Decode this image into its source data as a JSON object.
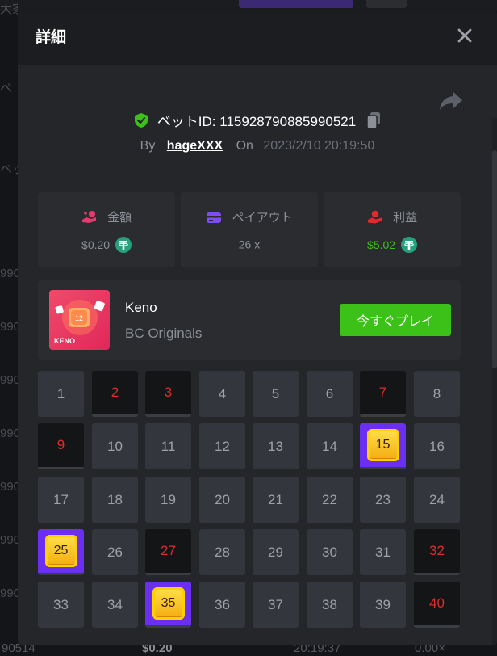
{
  "modal": {
    "title": "詳細",
    "bet_id_label": "ベットID: 115928790885990521",
    "by_label": "By",
    "username": "hageXXX",
    "on_label": "On",
    "datetime": "2023/2/10 20:19:50"
  },
  "stats": [
    {
      "label": "金額",
      "value": "$0.20",
      "icon": "coins-hand-icon",
      "currency_icon": "usdt-icon"
    },
    {
      "label": "ペイアウト",
      "value": "26 x",
      "icon": "wallet-card-icon"
    },
    {
      "label": "利益",
      "value": "$5.02",
      "icon": "profit-hand-icon",
      "currency_icon": "usdt-icon"
    }
  ],
  "game": {
    "name": "Keno",
    "provider": "BC Originals",
    "play_label": "今すぐプレイ",
    "thumb_number": "12",
    "thumb_text": "KENO"
  },
  "keno": {
    "numbers": [
      "1",
      "2",
      "3",
      "4",
      "5",
      "6",
      "7",
      "8",
      "9",
      "10",
      "11",
      "12",
      "13",
      "14",
      "15",
      "16",
      "17",
      "18",
      "19",
      "20",
      "21",
      "22",
      "23",
      "24",
      "25",
      "26",
      "27",
      "28",
      "29",
      "30",
      "31",
      "32",
      "33",
      "34",
      "35",
      "36",
      "37",
      "38",
      "39",
      "40"
    ],
    "drawn": [
      2,
      3,
      7,
      9,
      27,
      32,
      40
    ],
    "hits": [
      15,
      25,
      35
    ]
  },
  "background": {
    "left_fragments": [
      "大家さ",
      "ペ",
      "ベッ",
      "990",
      "990",
      "990",
      "990",
      "990",
      "990",
      "990"
    ],
    "bottom_row": [
      "90514",
      "$0.20",
      "20:19:37",
      "0.00×"
    ]
  },
  "colors": {
    "accent_green": "#3bc117",
    "hit_purple": "#6b2ff2",
    "drawn_red": "#e02b2b"
  }
}
